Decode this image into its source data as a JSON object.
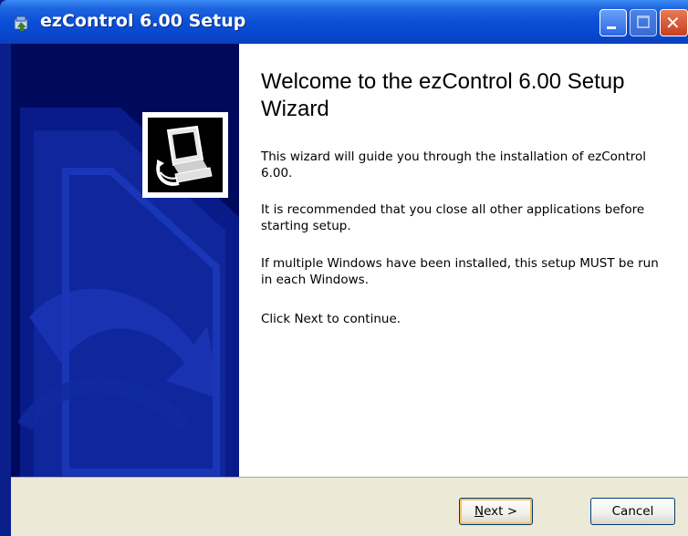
{
  "window": {
    "title": "ezControl 6.00 Setup"
  },
  "content": {
    "heading": "Welcome to the ezControl 6.00 Setup Wizard",
    "paragraphs": [
      "This wizard will guide you through the installation of ezControl 6.00.",
      "It is recommended that you close all other applications before starting setup.",
      "If multiple Windows have been installed, this setup MUST be run in each Windows.",
      "Click Next to continue."
    ]
  },
  "buttons": {
    "next": "Next >",
    "cancel": "Cancel"
  },
  "icons": {
    "title_icon": "installer-icon",
    "logo": "computer-install-icon",
    "minimize": "minimize-icon",
    "maximize": "maximize-icon",
    "close": "close-icon"
  },
  "colors": {
    "titlebar": "#0a4fd6",
    "banner": "#000a5c",
    "button_face": "#ece9d8"
  }
}
